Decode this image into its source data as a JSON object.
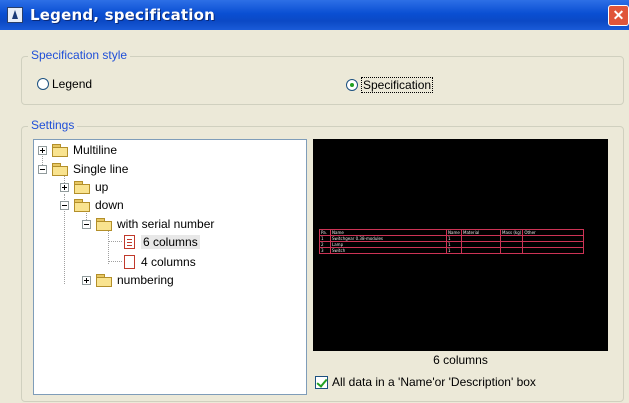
{
  "window": {
    "title": "Legend, specification",
    "close_glyph": "✕",
    "colors": {
      "titlebar": "#0a4fd3",
      "group_label": "#1f4fd8",
      "close": "#e0553a"
    }
  },
  "spec_style": {
    "label": "Specification style",
    "options": [
      {
        "label": "Legend",
        "checked": false
      },
      {
        "label": "Specification",
        "checked": true
      }
    ]
  },
  "settings": {
    "label": "Settings",
    "tree": [
      {
        "label": "Multiline",
        "expander": "plus",
        "icon": "folder"
      },
      {
        "label": "Single line",
        "expander": "minus",
        "icon": "folder"
      },
      {
        "label": "up",
        "expander": "plus",
        "icon": "folder"
      },
      {
        "label": "down",
        "expander": "minus",
        "icon": "folder"
      },
      {
        "label": "with serial number",
        "expander": "minus",
        "icon": "folder"
      },
      {
        "label": "6 columns",
        "icon": "table-doc",
        "selected": true
      },
      {
        "label": "4 columns",
        "icon": "blank-doc"
      },
      {
        "label": "numbering",
        "expander": "plus",
        "icon": "folder"
      }
    ],
    "preview": {
      "caption": "6 columns",
      "headers": [
        "Pa.",
        "Name",
        "Name",
        "Material",
        "Mass (kg)",
        "Other"
      ],
      "rows": [
        [
          "1",
          "Switchgear 0.38-modules",
          "1",
          "",
          "",
          ""
        ],
        [
          "2",
          "Lamp",
          "1",
          "",
          "",
          ""
        ],
        [
          "3",
          "Switch",
          "1",
          "",
          "",
          ""
        ]
      ]
    },
    "checkbox": {
      "label": "All data in a 'Name'or 'Description' box",
      "checked": true
    }
  }
}
